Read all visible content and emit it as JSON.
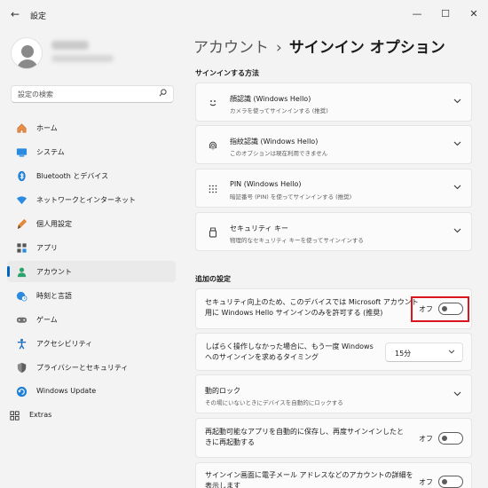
{
  "app": {
    "title": "設定",
    "back": "←",
    "minimize": "—",
    "maximize": "☐",
    "close": "✕"
  },
  "profile": {
    "name": "",
    "email": ""
  },
  "search": {
    "placeholder": "設定の検索",
    "icon": "search-icon"
  },
  "sidebar": {
    "items": [
      {
        "label": "ホーム",
        "icon": "home-icon",
        "selected": false
      },
      {
        "label": "システム",
        "icon": "monitor-icon",
        "selected": false
      },
      {
        "label": "Bluetooth とデバイス",
        "icon": "bluetooth-icon",
        "selected": false
      },
      {
        "label": "ネットワークとインターネット",
        "icon": "wifi-icon",
        "selected": false
      },
      {
        "label": "個人用設定",
        "icon": "brush-icon",
        "selected": false
      },
      {
        "label": "アプリ",
        "icon": "apps-icon",
        "selected": false
      },
      {
        "label": "アカウント",
        "icon": "person-icon",
        "selected": true
      },
      {
        "label": "時刻と言語",
        "icon": "globe-clock-icon",
        "selected": false
      },
      {
        "label": "ゲーム",
        "icon": "gamepad-icon",
        "selected": false
      },
      {
        "label": "アクセシビリティ",
        "icon": "accessibility-icon",
        "selected": false
      },
      {
        "label": "プライバシーとセキュリティ",
        "icon": "shield-icon",
        "selected": false
      },
      {
        "label": "Windows Update",
        "icon": "update-icon",
        "selected": false
      }
    ],
    "extras": {
      "label": "Extras",
      "icon": "extras-icon"
    }
  },
  "breadcrumb": {
    "parent": "アカウント",
    "separator": "›",
    "current": "サインイン オプション"
  },
  "signin_methods": {
    "title": "サインインする方法",
    "items": [
      {
        "title": "顔認識 (Windows Hello)",
        "subtitle": "カメラを使ってサインインする (推奨)",
        "icon": "face-icon"
      },
      {
        "title": "指紋認識 (Windows Hello)",
        "subtitle": "このオプションは現在利用できません",
        "icon": "fingerprint-icon"
      },
      {
        "title": "PIN (Windows Hello)",
        "subtitle": "暗証番号 (PIN) を使ってサインインする (推奨)",
        "icon": "pin-icon"
      },
      {
        "title": "セキュリティ キー",
        "subtitle": "物理的なセキュリティ キーを使ってサインインする",
        "icon": "usb-key-icon"
      }
    ]
  },
  "additional": {
    "title": "追加の設定",
    "hello_only": {
      "line1": "セキュリティ向上のため、このデバイスでは Microsoft アカウント",
      "line2": "用に Windows Hello サインインのみを許可する (推奨)",
      "state": "オフ"
    },
    "resignin": {
      "line1": "しばらく操作しなかった場合に、もう一度 Windows",
      "line2": "へのサインインを求めるタイミング",
      "value": "15分"
    },
    "dynamic_lock": {
      "title": "動的ロック",
      "subtitle": "その場にいないときにデバイスを自動的にロックする"
    },
    "restart_apps": {
      "line1": "再起動可能なアプリを自動的に保存し、再度サインインしたと",
      "line2": "きに再起動する",
      "state": "オフ"
    },
    "account_details": {
      "line1": "サインイン画面に電子メール アドレスなどのアカウントの詳細を",
      "line2": "表示します",
      "state": "オフ"
    }
  },
  "colors": {
    "accent": "#0067c0",
    "highlight": "#d9151e"
  }
}
